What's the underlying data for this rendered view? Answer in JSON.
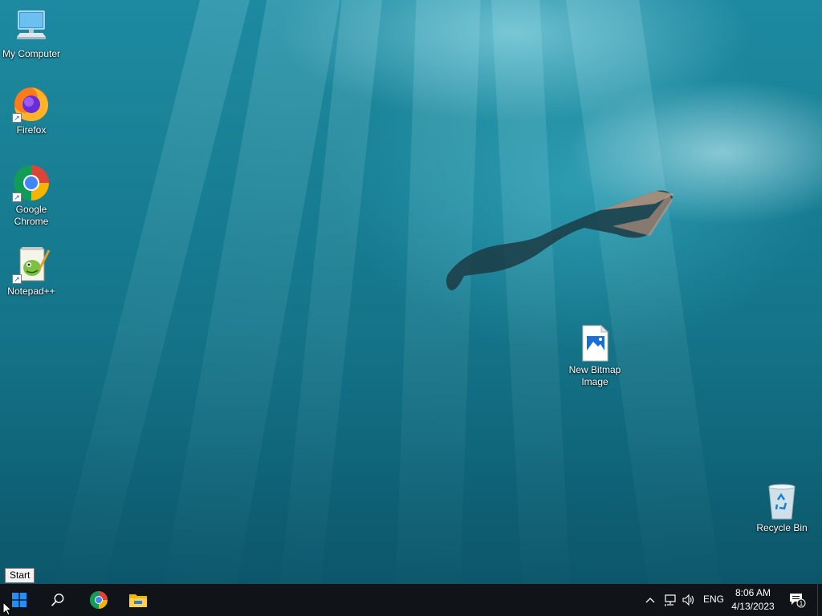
{
  "desktop": {
    "icons": [
      {
        "id": "my-computer",
        "label": "My Computer"
      },
      {
        "id": "firefox",
        "label": "Firefox"
      },
      {
        "id": "google-chrome",
        "label": "Google Chrome"
      },
      {
        "id": "notepadpp",
        "label": "Notepad++"
      },
      {
        "id": "new-bitmap-image",
        "label": "New Bitmap Image"
      },
      {
        "id": "recycle-bin",
        "label": "Recycle Bin"
      }
    ]
  },
  "tooltip": {
    "text": "Start"
  },
  "taskbar": {
    "pinned": [
      {
        "name": "start-button",
        "icon": "windows-logo-icon"
      },
      {
        "name": "search-button",
        "icon": "search-icon"
      },
      {
        "name": "chrome-taskbar-button",
        "icon": "chrome-icon"
      },
      {
        "name": "file-explorer-taskbar-button",
        "icon": "folder-icon"
      }
    ],
    "tray": {
      "language": "ENG",
      "time": "8:06 AM",
      "date": "4/13/2023",
      "notification_count": "1"
    }
  },
  "colors": {
    "taskbar": "#101418",
    "windows_blue": "#1e90ff",
    "water_dark": "#0c566a",
    "water_light": "#1d8aa2"
  }
}
